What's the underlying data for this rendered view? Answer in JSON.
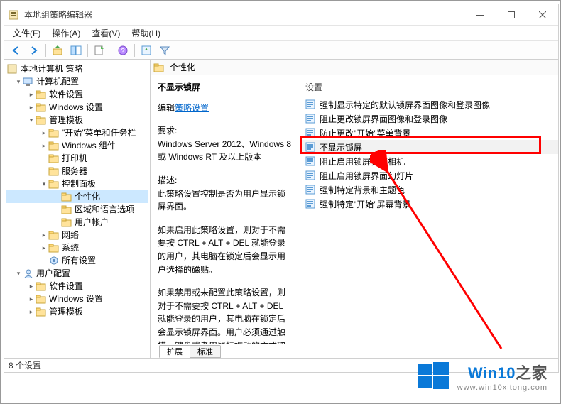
{
  "window": {
    "title": "本地组策略编辑器"
  },
  "menubar": {
    "file": "文件(F)",
    "action": "操作(A)",
    "view": "查看(V)",
    "help": "帮助(H)"
  },
  "tree": {
    "root": "本地计算机 策略",
    "computer": "计算机配置",
    "cc_soft": "软件设置",
    "cc_win": "Windows 设置",
    "cc_tmpl": "管理模板",
    "tmpl_start": "\"开始\"菜单和任务栏",
    "tmpl_wincomp": "Windows 组件",
    "tmpl_printer": "打印机",
    "tmpl_server": "服务器",
    "tmpl_cp": "控制面板",
    "cp_personal": "个性化",
    "cp_region": "区域和语言选项",
    "cp_user": "用户帐户",
    "tmpl_net": "网络",
    "tmpl_sys": "系统",
    "tmpl_all": "所有设置",
    "user": "用户配置",
    "uc_soft": "软件设置",
    "uc_win": "Windows 设置",
    "uc_tmpl": "管理模板"
  },
  "location": {
    "label": "个性化"
  },
  "detail": {
    "title": "不显示锁屏",
    "edit_prefix": "编辑",
    "edit_link": "策略设置",
    "req_label": "要求:",
    "req_text": "Windows Server 2012、Windows 8 或 Windows RT 及以上版本",
    "desc_label": "描述:",
    "desc1": "此策略设置控制是否为用户显示锁屏界面。",
    "desc2": "如果启用此策略设置，则对于不需要按 CTRL + ALT + DEL  就能登录的用户，其电脑在锁定后会显示用户选择的磁贴。",
    "desc3": "如果禁用或未配置此策略设置，则对于不需要按 CTRL + ALT + DEL 就能登录的用户，其电脑在锁定后会显示锁屏界面。用户必须通过触摸、键盘或者用鼠标拖动的方式取消锁屏界面。"
  },
  "settings": {
    "header": "设置",
    "items": [
      "强制显示特定的默认锁屏界面图像和登录图像",
      "阻止更改锁屏界面图像和登录图像",
      "防止更改\"开始\"菜单背景",
      "不显示锁屏",
      "阻止启用锁屏界面相机",
      "阻止启用锁屏界面幻灯片",
      "强制特定背景和主题色",
      "强制特定\"开始\"屏幕背景"
    ]
  },
  "tabs": {
    "extended": "扩展",
    "standard": "标准"
  },
  "status": {
    "count": "8 个设置"
  },
  "watermark": {
    "brand1": "Win10",
    "brand2": "之家",
    "url": "www.win10xitong.com"
  }
}
